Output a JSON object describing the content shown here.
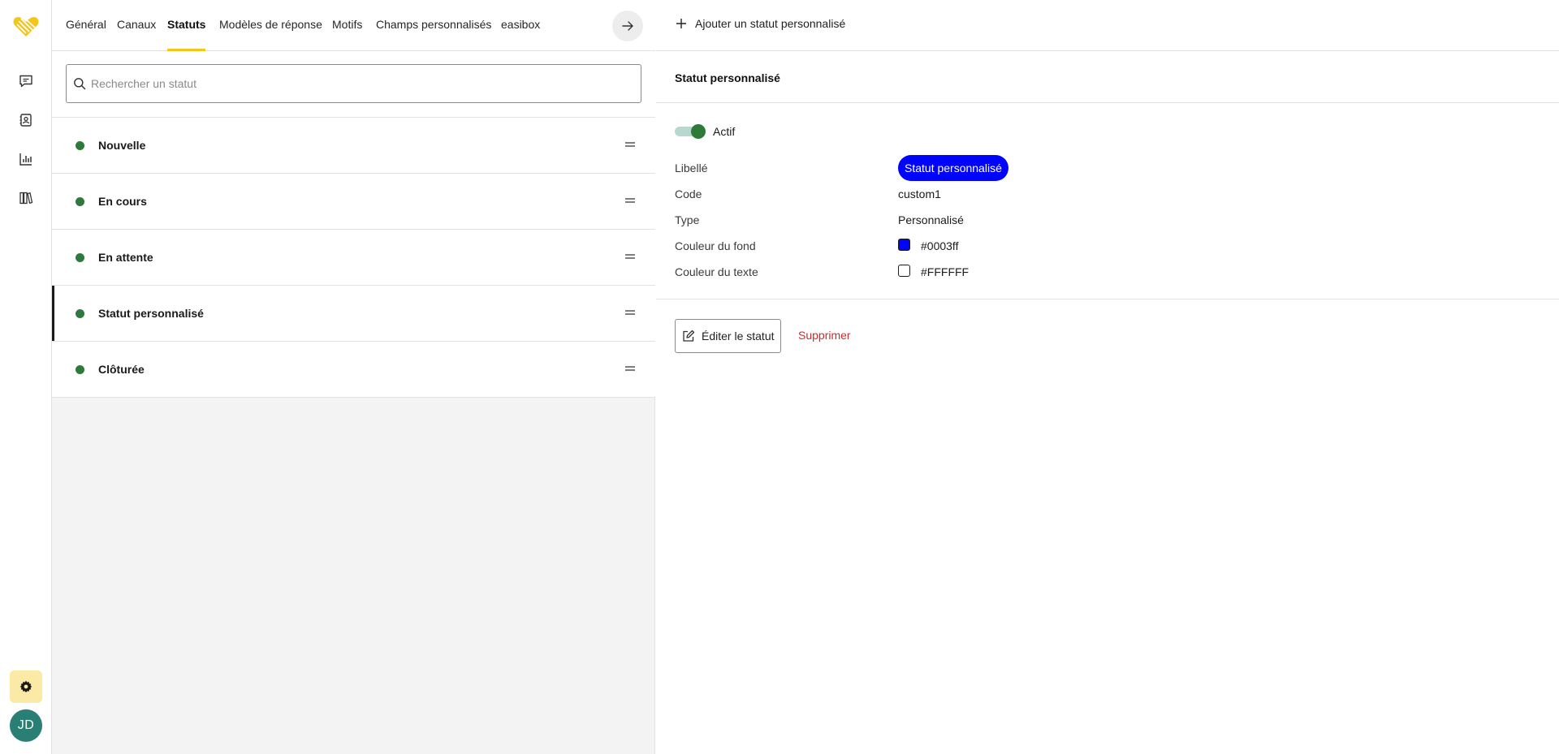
{
  "rail": {
    "items": [
      {
        "icon": "chat-icon"
      },
      {
        "icon": "contacts-icon"
      },
      {
        "icon": "analytics-icon"
      },
      {
        "icon": "library-icon"
      }
    ],
    "settings_icon": "gear-icon",
    "avatar_initials": "JD",
    "colors": {
      "settings_bg": "#fbe9a6",
      "avatar_bg": "#2a7f74",
      "brand": "#f5c518"
    }
  },
  "tabs": [
    {
      "label": "Général"
    },
    {
      "label": "Canaux"
    },
    {
      "label": "Statuts",
      "active": true
    },
    {
      "label": "Modèles de réponse"
    },
    {
      "label": "Motifs"
    },
    {
      "label": "Champs personnalisés"
    },
    {
      "label": "easibox"
    }
  ],
  "search": {
    "placeholder": "Rechercher un statut",
    "value": ""
  },
  "statuses": [
    {
      "label": "Nouvelle"
    },
    {
      "label": "En cours"
    },
    {
      "label": "En attente"
    },
    {
      "label": "Statut personnalisé",
      "selected": true
    },
    {
      "label": "Clôturée"
    }
  ],
  "status_dot_color": "#2d7a3a",
  "toolbar": {
    "add_label": "Ajouter un statut personnalisé"
  },
  "detail": {
    "title": "Statut personnalisé",
    "active_label": "Actif",
    "active": true,
    "fields": {
      "libelle_label": "Libellé",
      "libelle_value": "Statut personnalisé",
      "code_label": "Code",
      "code_value": "custom1",
      "type_label": "Type",
      "type_value": "Personnalisé",
      "bg_label": "Couleur du fond",
      "bg_value": "#0003ff",
      "text_label": "Couleur du texte",
      "text_value": "#FFFFFF"
    }
  },
  "actions": {
    "edit_label": "Éditer le statut",
    "delete_label": "Supprimer"
  }
}
